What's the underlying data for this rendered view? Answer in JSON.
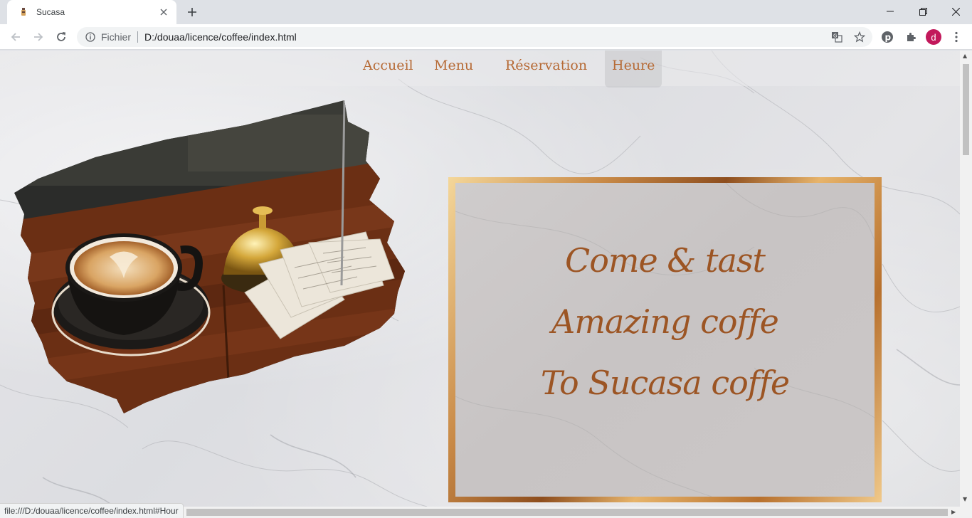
{
  "browser": {
    "tab": {
      "title": "Sucasa",
      "favicon": "coffee-favicon-icon",
      "close_icon": "close-icon"
    },
    "new_tab_icon": "plus-icon",
    "window_controls": [
      "minimize-icon",
      "restore-icon",
      "close-icon"
    ],
    "toolbar": {
      "back_icon": "back-arrow-icon",
      "forward_icon": "forward-arrow-icon",
      "reload_icon": "reload-icon",
      "site_info_icon": "info-icon",
      "protocol_label": "Fichier",
      "url": "D:/douaa/licence/coffee/index.html",
      "right_icons": [
        "translate-icon",
        "star-icon",
        "pinterest-icon",
        "extensions-icon"
      ],
      "profile_initial": "d",
      "menu_icon": "kebab-menu-icon"
    },
    "status_url": "file:///D:/douaa/licence/coffee/index.html#Hour"
  },
  "page": {
    "nav": {
      "items": [
        {
          "label": "Accueil",
          "active": false
        },
        {
          "label": "Menu",
          "active": false
        },
        {
          "label": "Réservation",
          "active": false
        },
        {
          "label": "Heure",
          "active": true
        }
      ]
    },
    "hero_image": "coffee-cup-on-wooden-table",
    "tagline": {
      "line1": "Come & tast",
      "line2": "Amazing coffe",
      "line3": "To Sucasa coffe"
    }
  },
  "colors": {
    "accent": "#b66a35",
    "tagline": "#9c5524",
    "gold_frame": "#c98a47",
    "profile": "#c2185b"
  }
}
